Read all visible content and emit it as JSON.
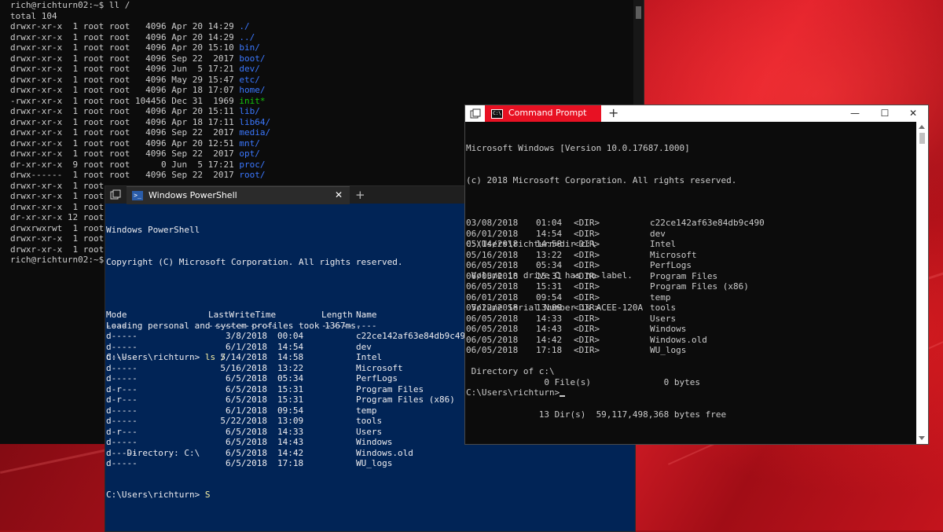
{
  "wsl": {
    "lines": [
      [
        {
          "t": "rich@richturn02:~$ ll /",
          "c": "c-gray"
        }
      ],
      [
        {
          "t": "total 104",
          "c": "c-gray"
        }
      ],
      [
        {
          "t": "drwxr-xr-x  1 root root   4096 Apr 20 14:29 ",
          "c": "c-gray"
        },
        {
          "t": "./",
          "c": "c-blue"
        }
      ],
      [
        {
          "t": "drwxr-xr-x  1 root root   4096 Apr 20 14:29 ",
          "c": "c-gray"
        },
        {
          "t": "../",
          "c": "c-blue"
        }
      ],
      [
        {
          "t": "drwxr-xr-x  1 root root   4096 Apr 20 15:10 ",
          "c": "c-gray"
        },
        {
          "t": "bin/",
          "c": "c-blue"
        }
      ],
      [
        {
          "t": "drwxr-xr-x  1 root root   4096 Sep 22  2017 ",
          "c": "c-gray"
        },
        {
          "t": "boot/",
          "c": "c-blue"
        }
      ],
      [
        {
          "t": "drwxr-xr-x  1 root root   4096 Jun  5 17:21 ",
          "c": "c-gray"
        },
        {
          "t": "dev/",
          "c": "c-blue"
        }
      ],
      [
        {
          "t": "drwxr-xr-x  1 root root   4096 May 29 15:47 ",
          "c": "c-gray"
        },
        {
          "t": "etc/",
          "c": "c-blue"
        }
      ],
      [
        {
          "t": "drwxr-xr-x  1 root root   4096 Apr 18 17:07 ",
          "c": "c-gray"
        },
        {
          "t": "home/",
          "c": "c-blue"
        }
      ],
      [
        {
          "t": "-rwxr-xr-x  1 root root 104456 Dec 31  1969 ",
          "c": "c-gray"
        },
        {
          "t": "init*",
          "c": "c-green"
        }
      ],
      [
        {
          "t": "drwxr-xr-x  1 root root   4096 Apr 20 15:11 ",
          "c": "c-gray"
        },
        {
          "t": "lib/",
          "c": "c-blue"
        }
      ],
      [
        {
          "t": "drwxr-xr-x  1 root root   4096 Apr 18 17:11 ",
          "c": "c-gray"
        },
        {
          "t": "lib64/",
          "c": "c-blue"
        }
      ],
      [
        {
          "t": "drwxr-xr-x  1 root root   4096 Sep 22  2017 ",
          "c": "c-gray"
        },
        {
          "t": "media/",
          "c": "c-blue"
        }
      ],
      [
        {
          "t": "drwxr-xr-x  1 root root   4096 Apr 20 12:51 ",
          "c": "c-gray"
        },
        {
          "t": "mnt/",
          "c": "c-blue"
        }
      ],
      [
        {
          "t": "drwxr-xr-x  1 root root   4096 Sep 22  2017 ",
          "c": "c-gray"
        },
        {
          "t": "opt/",
          "c": "c-blue"
        }
      ],
      [
        {
          "t": "dr-xr-xr-x  9 root root      0 Jun  5 17:21 ",
          "c": "c-gray"
        },
        {
          "t": "proc/",
          "c": "c-blue"
        }
      ],
      [
        {
          "t": "drwx------  1 root root   4096 Sep 22  2017 ",
          "c": "c-gray"
        },
        {
          "t": "root/",
          "c": "c-blue"
        }
      ],
      [
        {
          "t": "drwxr-xr-x  1 root",
          "c": "c-gray"
        }
      ],
      [
        {
          "t": "drwxr-xr-x  1 root",
          "c": "c-gray"
        }
      ],
      [
        {
          "t": "drwxr-xr-x  1 root",
          "c": "c-gray"
        }
      ],
      [
        {
          "t": "dr-xr-xr-x 12 root",
          "c": "c-gray"
        }
      ],
      [
        {
          "t": "drwxrwxrwt  1 root",
          "c": "c-gray"
        }
      ],
      [
        {
          "t": "drwxr-xr-x  1 root",
          "c": "c-gray"
        }
      ],
      [
        {
          "t": "drwxr-xr-x  1 root",
          "c": "c-gray"
        }
      ],
      [
        {
          "t": "rich@richturn02:~$",
          "c": "c-gray"
        }
      ]
    ]
  },
  "powershell": {
    "tab_title": "Windows PowerShell",
    "close_glyph": "✕",
    "new_tab_glyph": "+",
    "header_lines": [
      "Windows PowerShell",
      "Copyright (C) Microsoft Corporation. All rights reserved.",
      "",
      "Loading personal and system profiles took 1367ms."
    ],
    "prompt": "C:\\Users\\richturn> ",
    "command": "ls /",
    "directory_label": "    Directory: C:\\",
    "columns": {
      "mode": "Mode",
      "time": "LastWriteTime",
      "length": "Length",
      "name": "Name"
    },
    "underline": {
      "mode": "----",
      "time": "-------------",
      "length": "------",
      "name": "----"
    },
    "rows": [
      {
        "mode": "d-----",
        "date": "3/8/2018",
        "time": "00:04",
        "name": "c22ce142af63e84db9c490"
      },
      {
        "mode": "d-----",
        "date": "6/1/2018",
        "time": "14:54",
        "name": "dev"
      },
      {
        "mode": "d-----",
        "date": "5/14/2018",
        "time": "14:58",
        "name": "Intel"
      },
      {
        "mode": "d-----",
        "date": "5/16/2018",
        "time": "13:22",
        "name": "Microsoft"
      },
      {
        "mode": "d-----",
        "date": "6/5/2018",
        "time": "05:34",
        "name": "PerfLogs"
      },
      {
        "mode": "d-r---",
        "date": "6/5/2018",
        "time": "15:31",
        "name": "Program Files"
      },
      {
        "mode": "d-r---",
        "date": "6/5/2018",
        "time": "15:31",
        "name": "Program Files (x86)"
      },
      {
        "mode": "d-----",
        "date": "6/1/2018",
        "time": "09:54",
        "name": "temp"
      },
      {
        "mode": "d-----",
        "date": "5/22/2018",
        "time": "13:09",
        "name": "tools"
      },
      {
        "mode": "d-r---",
        "date": "6/5/2018",
        "time": "14:33",
        "name": "Users"
      },
      {
        "mode": "d-----",
        "date": "6/5/2018",
        "time": "14:43",
        "name": "Windows"
      },
      {
        "mode": "d-----",
        "date": "6/5/2018",
        "time": "14:42",
        "name": "Windows.old"
      },
      {
        "mode": "d-----",
        "date": "6/5/2018",
        "time": "17:18",
        "name": "WU_logs"
      }
    ],
    "final_prompt": "C:\\Users\\richturn> ",
    "final_input": "S"
  },
  "cmd": {
    "tab_title": "Command Prompt",
    "new_tab_glyph": "+",
    "controls": {
      "minimize": "—",
      "maximize": "☐",
      "close": "✕"
    },
    "header_lines": [
      "Microsoft Windows [Version 10.0.17687.1000]",
      "(c) 2018 Microsoft Corporation. All rights reserved.",
      "",
      "C:\\Users\\richturn>dir c:\\",
      " Volume in drive C has no label.",
      " Volume Serial Number is ACEE-120A",
      "",
      " Directory of c:\\"
    ],
    "rows": [
      {
        "date": "03/08/2018",
        "time": "01:04",
        "type": "<DIR>",
        "name": "c22ce142af63e84db9c490"
      },
      {
        "date": "06/01/2018",
        "time": "14:54",
        "type": "<DIR>",
        "name": "dev"
      },
      {
        "date": "05/14/2018",
        "time": "14:58",
        "type": "<DIR>",
        "name": "Intel"
      },
      {
        "date": "05/16/2018",
        "time": "13:22",
        "type": "<DIR>",
        "name": "Microsoft"
      },
      {
        "date": "06/05/2018",
        "time": "05:34",
        "type": "<DIR>",
        "name": "PerfLogs"
      },
      {
        "date": "06/05/2018",
        "time": "15:31",
        "type": "<DIR>",
        "name": "Program Files"
      },
      {
        "date": "06/05/2018",
        "time": "15:31",
        "type": "<DIR>",
        "name": "Program Files (x86)"
      },
      {
        "date": "06/01/2018",
        "time": "09:54",
        "type": "<DIR>",
        "name": "temp"
      },
      {
        "date": "05/22/2018",
        "time": "13:09",
        "type": "<DIR>",
        "name": "tools"
      },
      {
        "date": "06/05/2018",
        "time": "14:33",
        "type": "<DIR>",
        "name": "Users"
      },
      {
        "date": "06/05/2018",
        "time": "14:43",
        "type": "<DIR>",
        "name": "Windows"
      },
      {
        "date": "06/05/2018",
        "time": "14:42",
        "type": "<DIR>",
        "name": "Windows.old"
      },
      {
        "date": "06/05/2018",
        "time": "17:18",
        "type": "<DIR>",
        "name": "WU_logs"
      }
    ],
    "summary_lines": [
      "               0 File(s)              0 bytes",
      "              13 Dir(s)  59,117,498,368 bytes free"
    ],
    "final_prompt": "C:\\Users\\richturn>"
  },
  "colors": {
    "powershell_bg": "#012456",
    "cmd_accent": "#e81123",
    "terminal_bg": "#0c0c0c",
    "ls_dir": "#3b78ff",
    "ls_exec": "#16c60c",
    "ps_command": "#f9f1a5"
  }
}
